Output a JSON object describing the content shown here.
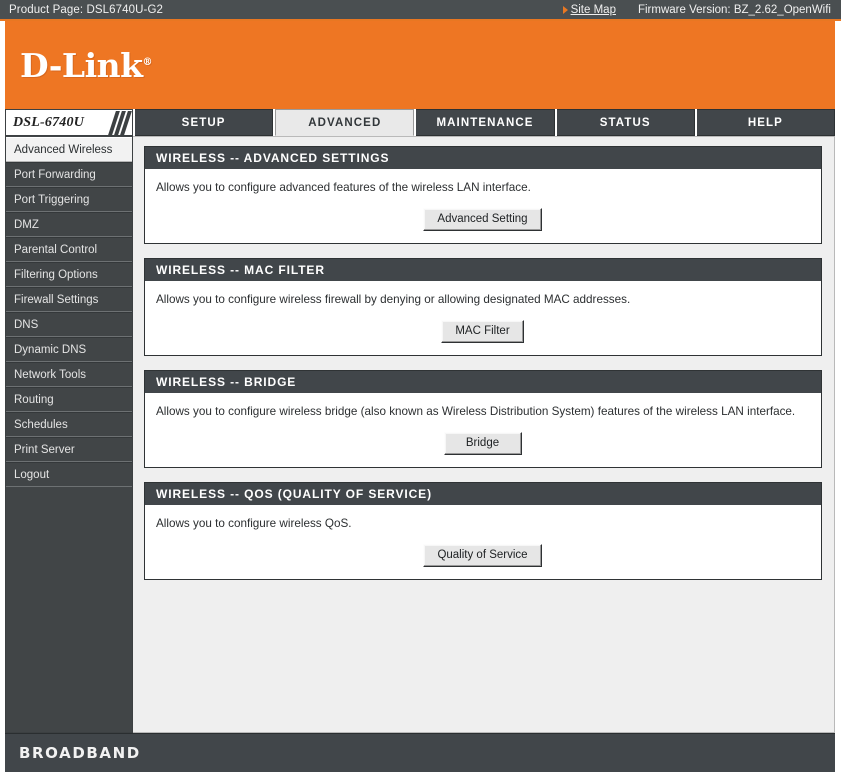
{
  "topbar": {
    "product_label": "Product Page: DSL6740U-G2",
    "site_map_label": "Site Map",
    "firmware_label": "Firmware Version: BZ_2.62_OpenWifi",
    "arrow_icon": "arrow-right-icon",
    "accent_color": "#e87722"
  },
  "banner": {
    "logo_text": "D-Link",
    "logo_registered": "®",
    "background_color": "#ee7623"
  },
  "nav": {
    "model_label": "DSL-6740U",
    "tabs": [
      {
        "label": "SETUP",
        "active": false
      },
      {
        "label": "ADVANCED",
        "active": true
      },
      {
        "label": "MAINTENANCE",
        "active": false
      },
      {
        "label": "STATUS",
        "active": false
      },
      {
        "label": "HELP",
        "active": false
      }
    ]
  },
  "sidebar": {
    "items": [
      {
        "label": "Advanced Wireless",
        "active": true
      },
      {
        "label": "Port Forwarding",
        "active": false
      },
      {
        "label": "Port Triggering",
        "active": false
      },
      {
        "label": "DMZ",
        "active": false
      },
      {
        "label": "Parental Control",
        "active": false
      },
      {
        "label": "Filtering Options",
        "active": false
      },
      {
        "label": "Firewall Settings",
        "active": false
      },
      {
        "label": "DNS",
        "active": false
      },
      {
        "label": "Dynamic DNS",
        "active": false
      },
      {
        "label": "Network Tools",
        "active": false
      },
      {
        "label": "Routing",
        "active": false
      },
      {
        "label": "Schedules",
        "active": false
      },
      {
        "label": "Print Server",
        "active": false
      },
      {
        "label": "Logout",
        "active": false
      }
    ]
  },
  "panels": [
    {
      "title": "WIRELESS -- ADVANCED SETTINGS",
      "description": "Allows you to configure advanced features of the wireless LAN interface.",
      "button_label": "Advanced Setting"
    },
    {
      "title": "WIRELESS -- MAC FILTER",
      "description": "Allows you to configure wireless firewall by denying or allowing designated MAC addresses.",
      "button_label": "MAC Filter"
    },
    {
      "title": "WIRELESS -- BRIDGE",
      "description": "Allows you to configure wireless bridge (also known as Wireless Distribution System) features of the wireless LAN interface.",
      "button_label": "Bridge"
    },
    {
      "title": "WIRELESS -- QOS (QUALITY OF SERVICE)",
      "description": "Allows you to configure wireless QoS.",
      "button_label": "Quality of Service"
    }
  ],
  "footer": {
    "brand": "BROADBAND"
  }
}
